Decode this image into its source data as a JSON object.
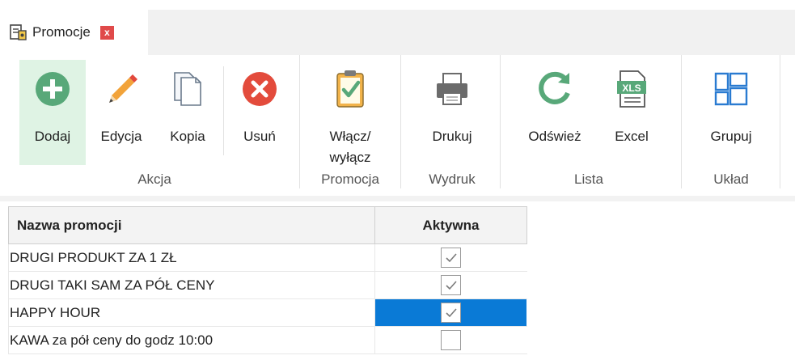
{
  "tab": {
    "label": "Promocje",
    "close": "x"
  },
  "ribbon": {
    "buttons": {
      "add": "Dodaj",
      "edit": "Edycja",
      "copy": "Kopia",
      "delete": "Usuń",
      "toggle": "Włącz/\nwyłącz",
      "print": "Drukuj",
      "refresh": "Odśwież",
      "excel": "Excel",
      "group": "Grupuj"
    },
    "excel_badge": "XLS",
    "groups": {
      "action": "Akcja",
      "promotion": "Promocja",
      "print": "Wydruk",
      "list": "Lista",
      "layout": "Układ"
    }
  },
  "table": {
    "headers": {
      "name": "Nazwa promocji",
      "active": "Aktywna"
    },
    "rows": [
      {
        "name": "DRUGI PRODUKT ZA 1 ZŁ",
        "active": true
      },
      {
        "name": "DRUGI TAKI SAM ZA PÓŁ CENY",
        "active": true
      },
      {
        "name": "HAPPY HOUR",
        "active": true
      },
      {
        "name": "KAWA za pół ceny do godz 10:00",
        "active": false
      }
    ],
    "selected_row": 2
  },
  "colors": {
    "accent_green": "#58a879",
    "delete_red": "#e34b3c",
    "selection_blue": "#0a7ad6",
    "group_icon_blue": "#2a7bd1"
  }
}
